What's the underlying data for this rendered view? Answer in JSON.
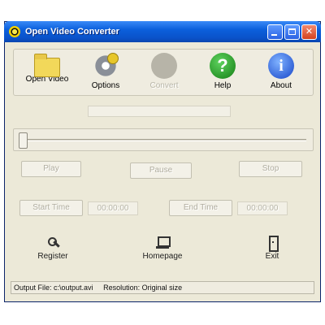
{
  "window": {
    "title": "Open Video Converter"
  },
  "toolbar": {
    "items": [
      {
        "label": "Open Video",
        "icon": "folder-icon",
        "enabled": true
      },
      {
        "label": "Options",
        "icon": "gear-icon",
        "enabled": true
      },
      {
        "label": "Convert",
        "icon": "disc-icon",
        "enabled": false
      },
      {
        "label": "Help",
        "icon": "help-icon",
        "enabled": true
      },
      {
        "label": "About",
        "icon": "info-icon",
        "enabled": true
      }
    ]
  },
  "playback": {
    "play_label": "Play",
    "pause_label": "Pause",
    "stop_label": "Stop",
    "position": 0
  },
  "range": {
    "start_label": "Start Time",
    "start_value": "00:00:00",
    "end_label": "End Time",
    "end_value": "00:00:00"
  },
  "links": {
    "register_label": "Register",
    "homepage_label": "Homepage",
    "exit_label": "Exit"
  },
  "status": {
    "output": "Output File: c:\\output.avi",
    "resolution": "Resolution: Original size"
  },
  "colors": {
    "titlebar": "#0b5fdc",
    "window_bg": "#ece9d8"
  }
}
